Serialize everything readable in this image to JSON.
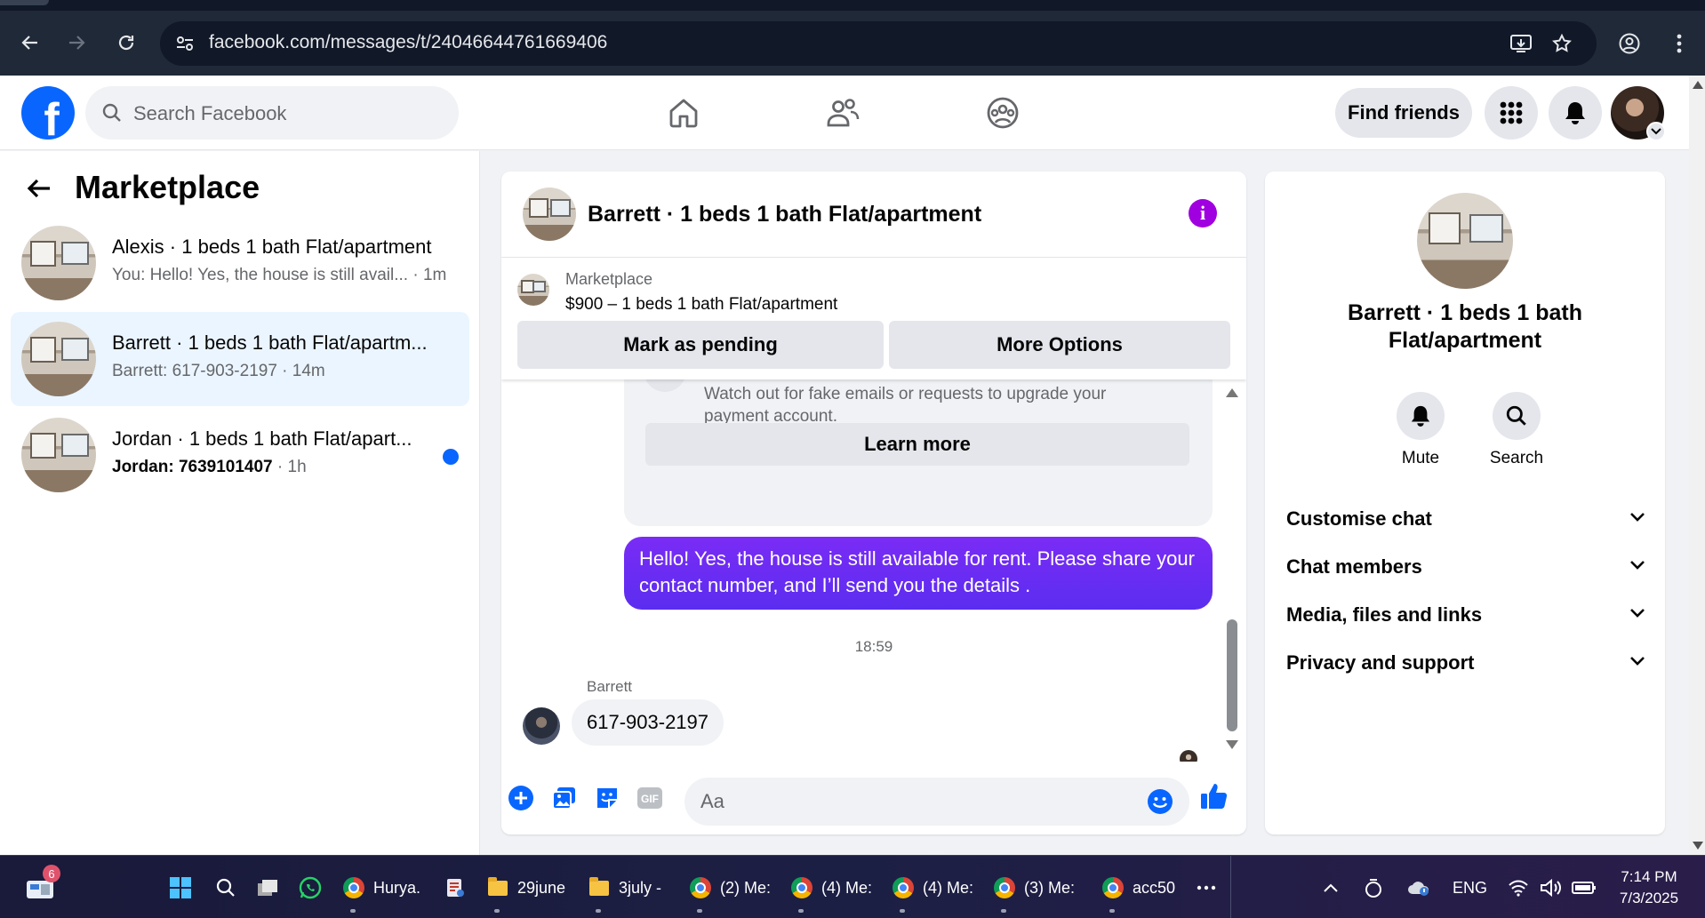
{
  "browser": {
    "url": "facebook.com/messages/t/24046644761669406"
  },
  "header": {
    "logo_letter": "f",
    "search_placeholder": "Search Facebook",
    "find_friends_label": "Find friends"
  },
  "left_panel": {
    "title": "Marketplace",
    "conversations": [
      {
        "name": "Alexis · 1 beds 1 bath Flat/apartment",
        "preview": "You: Hello! Yes, the house is still avail...",
        "time": " · 1m",
        "unread": false,
        "active": false
      },
      {
        "name": "Barrett · 1 beds 1 bath Flat/apartm...",
        "preview": "Barrett: 617-903-2197",
        "time": " · 14m",
        "unread": false,
        "active": true
      },
      {
        "name": "Jordan · 1 beds 1 bath Flat/apart...",
        "preview": "Jordan: 7639101407",
        "time": " · 1h",
        "unread": true,
        "active": false
      }
    ]
  },
  "chat": {
    "title": "Barrett · 1 beds 1 bath Flat/apartment",
    "listing_source": "Marketplace",
    "listing_price": "$900 – 1 beds 1 bath Flat/apartment",
    "mark_pending_label": "Mark as pending",
    "more_options_label": "More Options",
    "notice_text": "Watch out for fake emails or requests to upgrade your payment account.",
    "learn_more_label": "Learn more",
    "outgoing_message": "Hello! Yes, the house is still available for rent. Please share your contact number, and I’ll send you the details .",
    "timestamp": "18:59",
    "sender_name": "Barrett",
    "incoming_message": "617-903-2197",
    "composer_placeholder": "Aa"
  },
  "right_panel": {
    "title_line1": "Barrett · 1 beds 1 bath",
    "title_line2": "Flat/apartment",
    "mute_label": "Mute",
    "search_label": "Search",
    "sections": [
      "Customise chat",
      "Chat members",
      "Media, files and links",
      "Privacy and support"
    ]
  },
  "taskbar": {
    "notification_count": "6",
    "items": [
      "Hurya.",
      "29june",
      "3july -",
      "(2) Me:",
      "(4) Me:",
      "(4) Me:",
      "(3) Me:",
      "acc50"
    ],
    "language": "ENG",
    "time": "7:14 PM",
    "date": "7/3/2025"
  },
  "colors": {
    "fb_blue": "#0866ff",
    "outgoing_bubble": "#6a2cf2",
    "info_purple": "#a000e0"
  }
}
